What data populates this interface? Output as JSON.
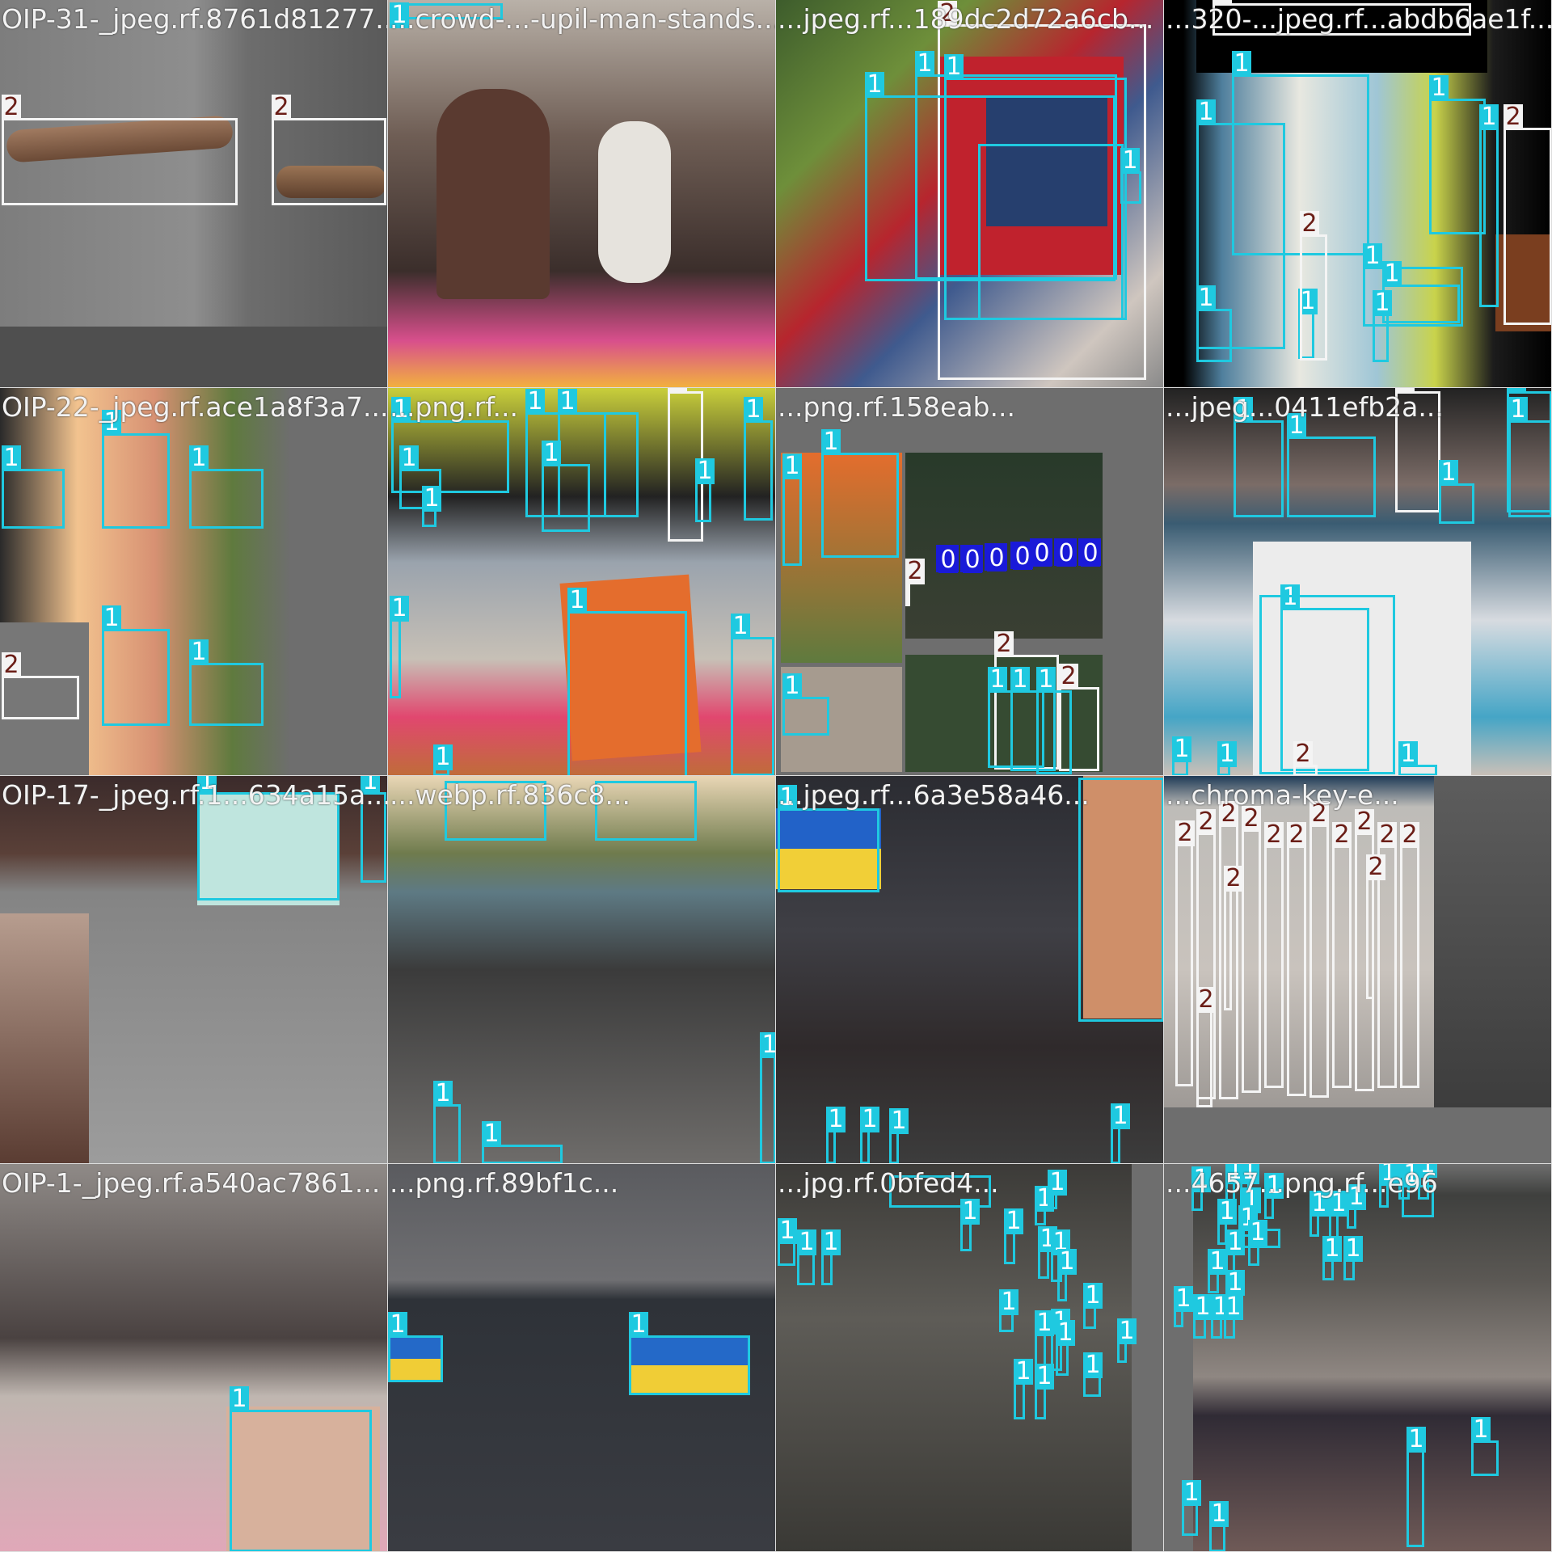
{
  "colors": {
    "class_0": "#1a1ad8",
    "class_1": "#1fc9e0",
    "class_2": "#f4f4f4",
    "class_2_text": "#6b1e17",
    "canvas_gray": "#6e6e6e"
  },
  "tiles": [
    {
      "title": "OIP-31-_jpeg.rf.8761d81277...",
      "labels": [
        "2",
        "2"
      ]
    },
    {
      "title": "...crowd-...-upil-man-stands...",
      "labels": [
        "1"
      ]
    },
    {
      "title": "...jpeg.rf...189dc2d72a6cb...",
      "labels": [
        "2",
        "1",
        "1",
        "1",
        "1",
        "1"
      ]
    },
    {
      "title": "...320-...jpeg.rf...abdb6ae1f...",
      "labels": [
        "2",
        "1",
        "1",
        "1",
        "1",
        "2",
        "1",
        "1",
        "1",
        "1",
        "2",
        "1"
      ]
    },
    {
      "title": "OIP-22-_jpeg.rf.ace1a8f3a7...",
      "labels": [
        "1",
        "1",
        "1",
        "1",
        "1",
        "2"
      ]
    },
    {
      "title": "...png.rf...",
      "labels": [
        "1",
        "1",
        "1",
        "2",
        "1",
        "1",
        "1",
        "1",
        "1",
        "1",
        "1",
        "1",
        "1"
      ]
    },
    {
      "title": "...png.rf.158eab...",
      "labels": [
        "1",
        "1",
        "0",
        "0",
        "0",
        "0",
        "0",
        "0",
        "0",
        "2",
        "2",
        "2",
        "1",
        "1",
        "1",
        "1"
      ]
    },
    {
      "title": "...jpeg...0411efb2a...",
      "labels": [
        "1",
        "2",
        "1",
        "1",
        "1",
        "1",
        "1",
        "1",
        "1",
        "1",
        "2",
        "1"
      ]
    },
    {
      "title": "OIP-17-_jpeg.rf.1...634a15a...",
      "labels": [
        "1",
        "1"
      ]
    },
    {
      "title": "...webp.rf.836c8...",
      "labels": [
        "1",
        "1",
        "1",
        "1",
        "1"
      ]
    },
    {
      "title": "...jpeg.rf...6a3e58a46...",
      "labels": [
        "1",
        "1",
        "1",
        "1",
        "1",
        "1"
      ]
    },
    {
      "title": "...chroma-key-e...",
      "labels": [
        "2",
        "2",
        "2",
        "2",
        "2",
        "2",
        "2",
        "2",
        "2",
        "2",
        "2",
        "2",
        "2",
        "2"
      ]
    },
    {
      "title": "OIP-1-_jpeg.rf.a540ac7861...",
      "labels": [
        "1"
      ]
    },
    {
      "title": "...png.rf.89bf1c...",
      "labels": [
        "1",
        "1"
      ]
    },
    {
      "title": "...jpg.rf.0bfed4...",
      "labels": [
        "1",
        "1",
        "1",
        "1",
        "1",
        "1",
        "1",
        "1",
        "1",
        "1",
        "1",
        "1",
        "1",
        "1",
        "1",
        "1",
        "1",
        "1",
        "1",
        "1"
      ]
    },
    {
      "title": "...4657...png.rf...e96",
      "labels": [
        "1",
        "1",
        "1",
        "1",
        "1",
        "1",
        "1",
        "1",
        "1",
        "1",
        "1",
        "1",
        "1",
        "1",
        "1",
        "1",
        "1",
        "1",
        "1",
        "1",
        "1",
        "1",
        "1",
        "1",
        "1",
        "1",
        "1",
        "1"
      ]
    }
  ]
}
